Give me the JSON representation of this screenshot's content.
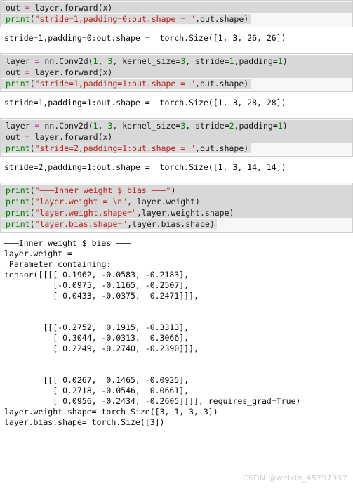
{
  "document": {
    "kind": "jupyter-notebook-screenshot",
    "language": "python"
  },
  "watermark": "CSDN @weixin_45797937",
  "cells": [
    {
      "id": "cell-1",
      "type": "code",
      "partial_top": true,
      "lines": [
        {
          "id": "c1l1",
          "plain": "out = layer.forward(x)",
          "tokens": [
            {
              "t": "out ",
              "c": "pl"
            },
            {
              "t": "=",
              "c": "op"
            },
            {
              "t": " layer.forward(x)",
              "c": "pl"
            }
          ]
        },
        {
          "id": "c1l2",
          "last": true,
          "plain": "print(\"stride=1,padding=0:out.shape = \",out.shape)",
          "tokens": [
            {
              "t": "print",
              "c": "kw"
            },
            {
              "t": "(",
              "c": "pl"
            },
            {
              "t": "\"stride=1,padding=0:out.shape = \"",
              "c": "str"
            },
            {
              "t": ",out.shape)",
              "c": "pl"
            }
          ]
        }
      ],
      "output": [
        "stride=1,padding=0:out.shape =  torch.Size([1, 3, 26, 26])"
      ]
    },
    {
      "id": "cell-2",
      "type": "code",
      "partial_top": false,
      "lines": [
        {
          "id": "c2l1",
          "plain": "layer = nn.Conv2d(1, 3, kernel_size=3, stride=1,padding=1)",
          "tokens": [
            {
              "t": "layer ",
              "c": "pl"
            },
            {
              "t": "=",
              "c": "op"
            },
            {
              "t": " nn.Conv2d(",
              "c": "pl"
            },
            {
              "t": "1",
              "c": "num"
            },
            {
              "t": ", ",
              "c": "pl"
            },
            {
              "t": "3",
              "c": "num"
            },
            {
              "t": ", kernel_size=",
              "c": "pl"
            },
            {
              "t": "3",
              "c": "num"
            },
            {
              "t": ", stride=",
              "c": "pl"
            },
            {
              "t": "1",
              "c": "num"
            },
            {
              "t": ",padding=",
              "c": "pl"
            },
            {
              "t": "1",
              "c": "num"
            },
            {
              "t": ")",
              "c": "pl"
            }
          ]
        },
        {
          "id": "c2l2",
          "plain": "out = layer.forward(x)",
          "tokens": [
            {
              "t": "out ",
              "c": "pl"
            },
            {
              "t": "=",
              "c": "op"
            },
            {
              "t": " layer.forward(x)",
              "c": "pl"
            }
          ]
        },
        {
          "id": "c2l3",
          "last": true,
          "plain": "print(\"stride=1,padding=1:out.shape = \",out.shape)",
          "tokens": [
            {
              "t": "print",
              "c": "kw"
            },
            {
              "t": "(",
              "c": "pl"
            },
            {
              "t": "\"stride=1,padding=1:out.shape = \"",
              "c": "str"
            },
            {
              "t": ",out.shape)",
              "c": "pl"
            }
          ]
        }
      ],
      "output": [
        "stride=1,padding=1:out.shape =  torch.Size([1, 3, 28, 28])"
      ]
    },
    {
      "id": "cell-3",
      "type": "code",
      "partial_top": false,
      "lines": [
        {
          "id": "c3l1",
          "plain": "layer = nn.Conv2d(1, 3, kernel_size=3, stride=2,padding=1)",
          "tokens": [
            {
              "t": "layer ",
              "c": "pl"
            },
            {
              "t": "=",
              "c": "op"
            },
            {
              "t": " nn.Conv2d(",
              "c": "pl"
            },
            {
              "t": "1",
              "c": "num"
            },
            {
              "t": ", ",
              "c": "pl"
            },
            {
              "t": "3",
              "c": "num"
            },
            {
              "t": ", kernel_size=",
              "c": "pl"
            },
            {
              "t": "3",
              "c": "num"
            },
            {
              "t": ", stride=",
              "c": "pl"
            },
            {
              "t": "2",
              "c": "num"
            },
            {
              "t": ",padding=",
              "c": "pl"
            },
            {
              "t": "1",
              "c": "num"
            },
            {
              "t": ")",
              "c": "pl"
            }
          ]
        },
        {
          "id": "c3l2",
          "plain": "out = layer.forward(x)",
          "tokens": [
            {
              "t": "out ",
              "c": "pl"
            },
            {
              "t": "=",
              "c": "op"
            },
            {
              "t": " layer.forward(x)",
              "c": "pl"
            }
          ]
        },
        {
          "id": "c3l3",
          "last": true,
          "plain": "print(\"stride=2,padding=1:out.shape = \",out.shape)",
          "tokens": [
            {
              "t": "print",
              "c": "kw"
            },
            {
              "t": "(",
              "c": "pl"
            },
            {
              "t": "\"stride=2,padding=1:out.shape = \"",
              "c": "str"
            },
            {
              "t": ",out.shape)",
              "c": "pl"
            }
          ]
        }
      ],
      "output": [
        "stride=2,padding=1:out.shape =  torch.Size([1, 3, 14, 14])"
      ]
    },
    {
      "id": "cell-4",
      "type": "code",
      "partial_top": false,
      "lines": [
        {
          "id": "c4l1",
          "plain": "print(\"——Inner weight $ bias ——\")",
          "tokens": [
            {
              "t": "print",
              "c": "kw"
            },
            {
              "t": "(",
              "c": "pl"
            },
            {
              "t": "\"———Inner weight $ bias ———\"",
              "c": "str"
            },
            {
              "t": ")",
              "c": "pl"
            }
          ]
        },
        {
          "id": "c4l2",
          "plain": "print(\"layer.weight = \\n\", layer.weight)",
          "tokens": [
            {
              "t": "print",
              "c": "kw"
            },
            {
              "t": "(",
              "c": "pl"
            },
            {
              "t": "\"layer.weight = \\n\"",
              "c": "str"
            },
            {
              "t": ", layer.weight)",
              "c": "pl"
            }
          ]
        },
        {
          "id": "c4l3",
          "plain": "print(\"layer.weight.shape=\",layer.weight.shape)",
          "tokens": [
            {
              "t": "print",
              "c": "kw"
            },
            {
              "t": "(",
              "c": "pl"
            },
            {
              "t": "\"layer.weight.shape=\"",
              "c": "str"
            },
            {
              "t": ",layer.weight.shape)",
              "c": "pl"
            }
          ]
        },
        {
          "id": "c4l4",
          "last": true,
          "plain": "print(\"layer.bias.shape=\",layer.bias.shape)",
          "tokens": [
            {
              "t": "print",
              "c": "kw"
            },
            {
              "t": "(",
              "c": "pl"
            },
            {
              "t": "\"layer.bias.shape=\"",
              "c": "str"
            },
            {
              "t": ",layer.bias.shape)",
              "c": "pl"
            }
          ]
        }
      ],
      "output": [
        "———Inner weight $ bias ———",
        "layer.weight =",
        " Parameter containing:",
        "tensor([[[[ 0.1962, -0.0583, -0.2183],",
        "          [-0.0975, -0.1165, -0.2507],",
        "          [ 0.0433, -0.0375,  0.2471]]],",
        "",
        "",
        "        [[[-0.2752,  0.1915, -0.3313],",
        "          [ 0.3044, -0.0313,  0.3066],",
        "          [ 0.2249, -0.2740, -0.2390]]],",
        "",
        "",
        "        [[[ 0.0267,  0.1465, -0.0925],",
        "          [ 0.2718, -0.0546,  0.0661],",
        "          [ 0.0956, -0.2434, -0.2605]]]], requires_grad=True)",
        "layer.weight.shape= torch.Size([3, 1, 3, 3])",
        "layer.bias.shape= torch.Size([3])"
      ]
    }
  ]
}
